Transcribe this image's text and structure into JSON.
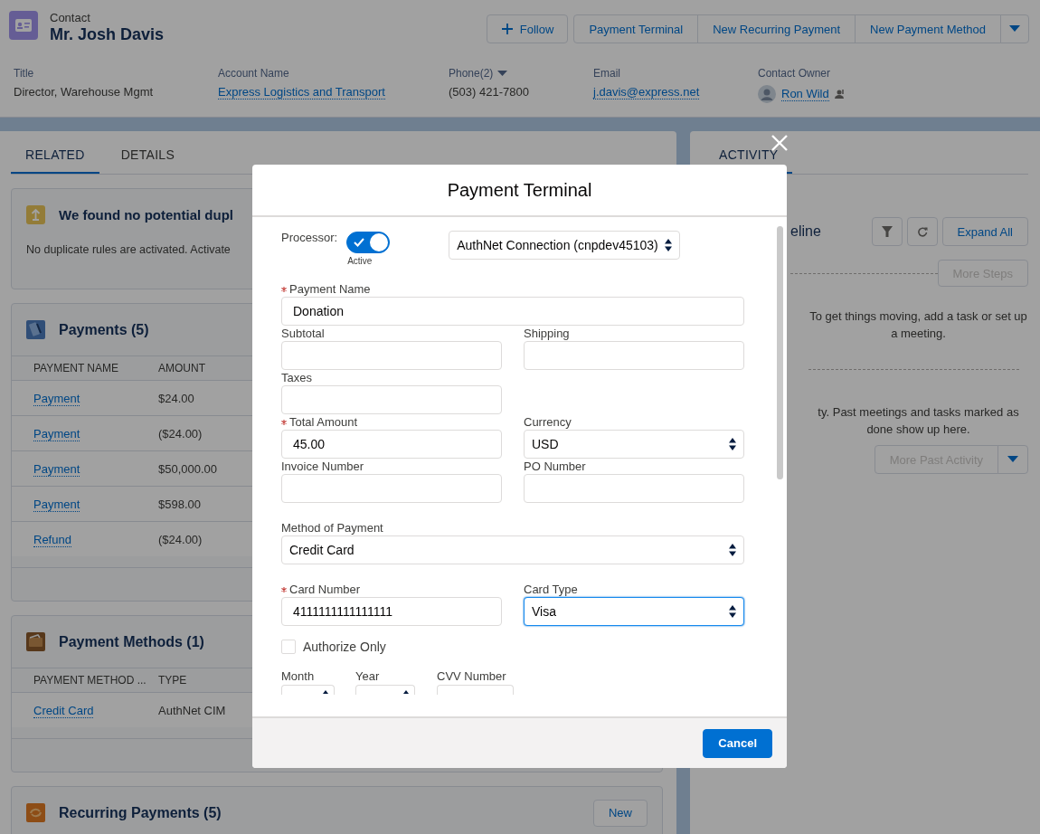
{
  "record": {
    "object_type": "Contact",
    "name": "Mr. Josh Davis",
    "follow_label": "Follow",
    "actions": [
      "Payment Terminal",
      "New Recurring Payment",
      "New Payment Method"
    ]
  },
  "highlights": [
    {
      "label": "Title",
      "value": "Director, Warehouse Mgmt",
      "kind": "text"
    },
    {
      "label": "Account Name",
      "value": "Express Logistics and Transport",
      "kind": "link"
    },
    {
      "label": "Phone(2)",
      "value": "(503) 421-7800",
      "kind": "menu"
    },
    {
      "label": "Email",
      "value": "j.davis@express.net",
      "kind": "link"
    },
    {
      "label": "Contact Owner",
      "value": "Ron Wild",
      "kind": "owner"
    }
  ],
  "tabs": [
    {
      "label": "RELATED",
      "selected": true
    },
    {
      "label": "DETAILS",
      "selected": false
    }
  ],
  "duplicates": {
    "title": "We found no potential dupl",
    "message": "No duplicate rules are activated. Activate"
  },
  "related_lists": [
    {
      "title": "Payments (5)",
      "kind": "card",
      "columns": [
        "PAYMENT NAME",
        "AMOUNT"
      ],
      "rows": [
        [
          "Payment",
          "$24.00"
        ],
        [
          "Payment",
          "($24.00)"
        ],
        [
          "Payment",
          "$50,000.00"
        ],
        [
          "Payment",
          "$598.00"
        ],
        [
          "Refund",
          "($24.00)"
        ]
      ]
    },
    {
      "title": "Payment Methods (1)",
      "kind": "wallet",
      "columns": [
        "PAYMENT METHOD ...",
        "TYPE"
      ],
      "rows": [
        [
          "Credit Card",
          "AuthNet CIM"
        ]
      ]
    },
    {
      "title": "Recurring Payments (5)",
      "kind": "recurring",
      "new_label": "New"
    }
  ],
  "activity": {
    "tabs": [
      {
        "label": "ACTIVITY",
        "selected": true
      }
    ],
    "heading": "eline",
    "expand_label": "Expand All",
    "more_steps": {
      "label": "More Steps",
      "disabled": true
    },
    "upcoming_text": "To get things moving, add a task or set up a meeting.",
    "past_text": "ty. Past meetings and tasks marked as done show up here.",
    "more_past": {
      "label": "More Past Activity",
      "disabled": true
    }
  },
  "modal": {
    "title": "Payment Terminal",
    "processor": {
      "label": "Processor:",
      "on": true,
      "status": "Active",
      "connection": "AuthNet Connection (cnpdev45103)"
    },
    "payment_name": {
      "kind": "input",
      "label": "Payment Name",
      "required": true,
      "value": "Donation"
    },
    "subtotal": {
      "kind": "input",
      "label": "Subtotal",
      "required": false
    },
    "shipping": {
      "kind": "input",
      "label": "Shipping",
      "required": false
    },
    "taxes": {
      "kind": "input",
      "label": "Taxes",
      "required": false
    },
    "total_amount": {
      "kind": "input",
      "label": "Total Amount",
      "required": true,
      "value": "45.00"
    },
    "currency": {
      "kind": "select",
      "label": "Currency",
      "required": false,
      "value": "USD",
      "focused": false
    },
    "invoice_number": {
      "kind": "input",
      "label": "Invoice Number",
      "required": false
    },
    "po_number": {
      "kind": "input",
      "label": "PO Number",
      "required": false
    },
    "method_of_payment": {
      "kind": "select",
      "label": "Method of Payment",
      "required": false,
      "value": "Credit Card",
      "focused": false
    },
    "card_number": {
      "kind": "input",
      "label": "Card Number",
      "required": true,
      "value": "4111111111111111"
    },
    "card_type": {
      "kind": "select",
      "label": "Card Type",
      "required": false,
      "value": "Visa",
      "focused": true
    },
    "authorize_only": {
      "label": "Authorize Only",
      "checked": false
    },
    "month": {
      "kind": "select",
      "label": "Month",
      "required": false
    },
    "year": {
      "kind": "select",
      "label": "Year",
      "required": false
    },
    "cvv_number": {
      "kind": "input",
      "label": "CVV Number",
      "required": false
    },
    "cancel_label": "Cancel"
  }
}
